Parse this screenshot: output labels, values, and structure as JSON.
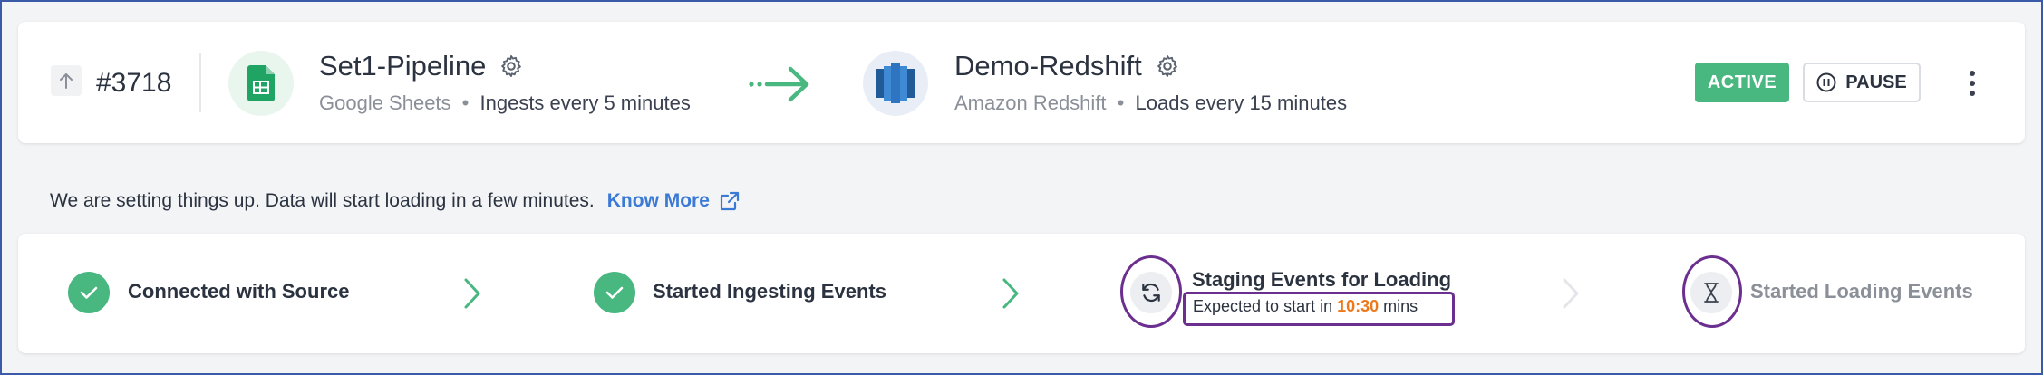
{
  "pipeline": {
    "id": "#3718",
    "source": {
      "name": "Set1-Pipeline",
      "type": "Google Sheets",
      "schedule": "Ingests every 5 minutes",
      "logo_icon": "google-sheets-logo"
    },
    "destination": {
      "name": "Demo-Redshift",
      "type": "Amazon Redshift",
      "schedule": "Loads every 15 minutes",
      "logo_icon": "amazon-redshift-logo"
    },
    "status": "ACTIVE",
    "pause_label": "PAUSE",
    "separator": "•"
  },
  "info": {
    "message": "We are setting things up. Data will start loading in a few minutes.",
    "know_more_label": "Know More"
  },
  "steps": [
    {
      "label": "Connected with Source",
      "state": "done",
      "icon": "check-icon"
    },
    {
      "label": "Started Ingesting Events",
      "state": "done",
      "icon": "check-icon"
    },
    {
      "label": "Staging Events for Loading",
      "state": "in-progress",
      "icon": "sync-icon",
      "expected_prefix": "Expected to start in",
      "expected_time": "10:30",
      "expected_suffix": "mins"
    },
    {
      "label": "Started Loading Events",
      "state": "pending",
      "icon": "hourglass-icon"
    }
  ],
  "colors": {
    "accent_green": "#48b880",
    "link_blue": "#3a79d4",
    "highlight_purple": "#6b2f8f",
    "time_orange": "#ec7a1c"
  }
}
